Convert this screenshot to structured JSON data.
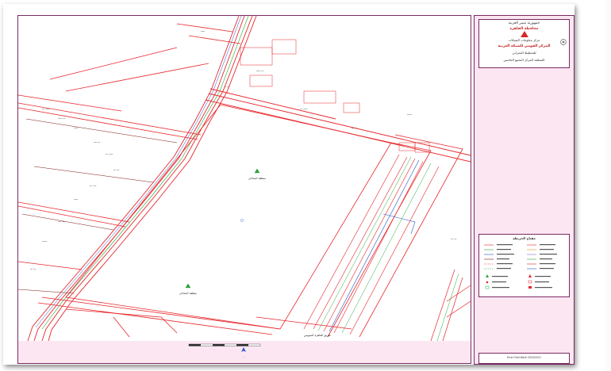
{
  "title_block": {
    "line1": "جمهورية مصر العربية",
    "line2": "محافظة القاهرة",
    "line3": "مركز معلومات الشبكات",
    "line4": "المركز القومي للشبكة العربية",
    "line5": "للتخطيط العمراني",
    "line6": "المنطقة المركز التجمع الخامس"
  },
  "legend": {
    "title": "مفتاح الخريطة"
  },
  "footer": {
    "text": "Final Field Work 2020/2021"
  },
  "map": {
    "block_label_top": "منطقة المحاجر",
    "block_label_bottom": "منطقة المحاجر",
    "bottom_road_label": "طريق القاهرة السويس"
  },
  "colors": {
    "road_red": "#e8262b",
    "road_dark": "#7a1a10",
    "line_green": "#2aa83a",
    "line_blue": "#2456c8",
    "frame_border": "#7a2a60",
    "panel_fill": "#fbe6f2"
  }
}
